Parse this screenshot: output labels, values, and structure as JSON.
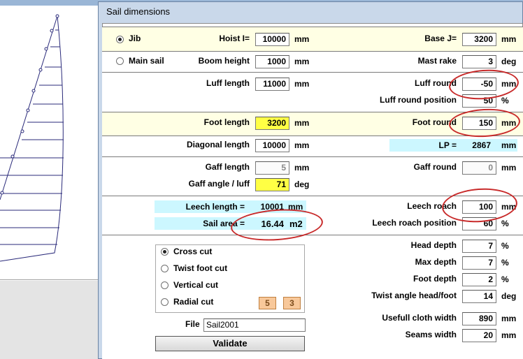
{
  "window": {
    "title": "Sail dimensions"
  },
  "sail_type": {
    "jib": {
      "label": "Jib",
      "selected": true
    },
    "mainsail": {
      "label": "Main sail",
      "selected": false
    }
  },
  "fields": {
    "hoist": {
      "label": "Hoist I=",
      "value": "10000",
      "unit": "mm"
    },
    "base": {
      "label": "Base J=",
      "value": "3200",
      "unit": "mm"
    },
    "boom_height": {
      "label": "Boom height",
      "value": "1000",
      "unit": "mm"
    },
    "mast_rake": {
      "label": "Mast rake",
      "value": "3",
      "unit": "deg"
    },
    "luff_length": {
      "label": "Luff length",
      "value": "11000",
      "unit": "mm"
    },
    "luff_round": {
      "label": "Luff round",
      "value": "-50",
      "unit": "mm"
    },
    "luff_round_position": {
      "label": "Luff round position",
      "value": "50",
      "unit": "%"
    },
    "foot_length": {
      "label": "Foot length",
      "value": "3200",
      "unit": "mm"
    },
    "foot_round": {
      "label": "Foot round",
      "value": "150",
      "unit": "mm"
    },
    "diagonal_length": {
      "label": "Diagonal length",
      "value": "10000",
      "unit": "mm"
    },
    "lp": {
      "label": "LP =",
      "value": "2867",
      "unit": "mm"
    },
    "gaff_length": {
      "label": "Gaff length",
      "value": "5",
      "unit": "mm"
    },
    "gaff_round": {
      "label": "Gaff round",
      "value": "0",
      "unit": "mm"
    },
    "gaff_angle": {
      "label": "Gaff angle / luff",
      "value": "71",
      "unit": "deg"
    },
    "leech_length": {
      "label": "Leech length =",
      "value": "10001",
      "unit": "mm"
    },
    "leech_roach": {
      "label": "Leech roach",
      "value": "100",
      "unit": "mm"
    },
    "sail_area": {
      "label": "Sail area =",
      "value": "16.44",
      "unit": "m2"
    },
    "leech_roach_position": {
      "label": "Leech roach position",
      "value": "60",
      "unit": "%"
    },
    "head_depth": {
      "label": "Head depth",
      "value": "7",
      "unit": "%"
    },
    "max_depth": {
      "label": "Max depth",
      "value": "7",
      "unit": "%"
    },
    "foot_depth": {
      "label": "Foot depth",
      "value": "2",
      "unit": "%"
    },
    "twist_angle": {
      "label": "Twist angle head/foot",
      "value": "14",
      "unit": "deg"
    },
    "usefull_cloth_width": {
      "label": "Usefull cloth width",
      "value": "890",
      "unit": "mm"
    },
    "seams_width": {
      "label": "Seams width",
      "value": "20",
      "unit": "mm"
    }
  },
  "cut": {
    "options": [
      {
        "label": "Cross cut",
        "selected": true
      },
      {
        "label": "Twist foot cut",
        "selected": false
      },
      {
        "label": "Vertical cut",
        "selected": false
      },
      {
        "label": "Radial cut",
        "selected": false
      }
    ],
    "radial_a": "5",
    "radial_b": "3"
  },
  "file": {
    "label": "File",
    "value": "Sail2001"
  },
  "validate_label": "Validate",
  "colors": {
    "highlight_yellow": "#ffff44",
    "info_cyan": "#ccf7ff",
    "annotation_red": "#c82a2a"
  }
}
